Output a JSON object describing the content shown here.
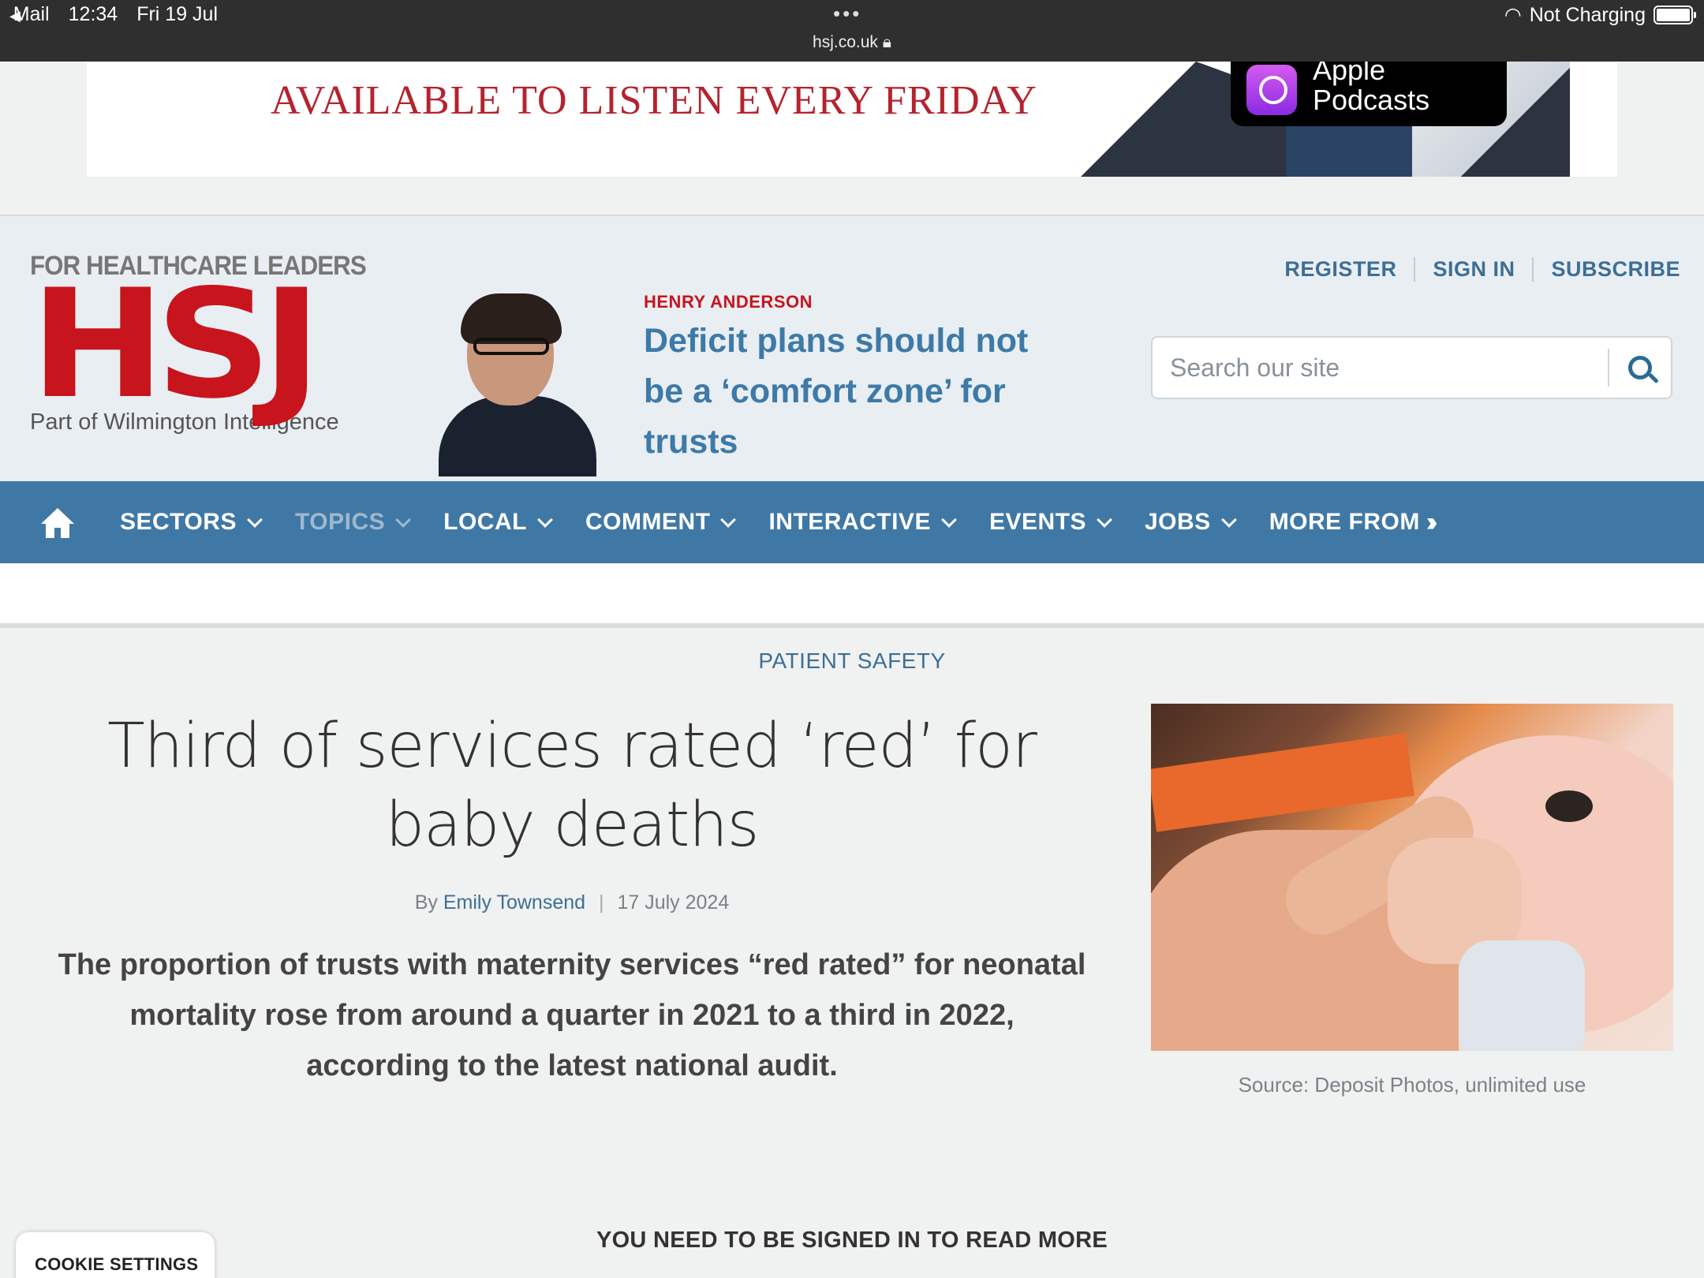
{
  "status_bar": {
    "back_app": "Mail",
    "time": "12:34",
    "date": "Fri 19 Jul",
    "url": "hsj.co.uk",
    "charging": "Not Charging"
  },
  "ad": {
    "text": "AVAILABLE TO LISTEN EVERY FRIDAY",
    "podcast_line1": "Apple",
    "podcast_line2": "Podcasts"
  },
  "header": {
    "logo_tagline": "FOR HEALTHCARE LEADERS",
    "logo_mark": "HSJ",
    "logo_subtitle": "Part of Wilmington Intelligence",
    "promo_author": "HENRY ANDERSON",
    "promo_title": "Deficit plans should not be a ‘comfort zone’ for trusts",
    "links": [
      "REGISTER",
      "SIGN IN",
      "SUBSCRIBE"
    ],
    "search_placeholder": "Search our site"
  },
  "nav": {
    "items": [
      "SECTORS",
      "TOPICS",
      "LOCAL",
      "COMMENT",
      "INTERACTIVE",
      "EVENTS",
      "JOBS",
      "MORE FROM"
    ]
  },
  "article": {
    "category": "PATIENT SAFETY",
    "headline": "Third of services rated ‘red’ for baby deaths",
    "by": "By",
    "author": "Emily Townsend",
    "date": "17 July 2024",
    "standfirst": "The proportion of trusts with maternity services “red rated” for neonatal mortality rose from around a quarter in 2021 to a third in 2022, according to the latest national audit.",
    "image_caption": "Source: Deposit Photos, unlimited use",
    "signin_notice": "YOU NEED TO BE SIGNED IN TO READ MORE"
  },
  "cookie_button": "COOKIE SETTINGS",
  "colors": {
    "brand_red": "#c8141c",
    "nav_blue": "#3f78a5",
    "link_blue": "#3d6f95"
  }
}
